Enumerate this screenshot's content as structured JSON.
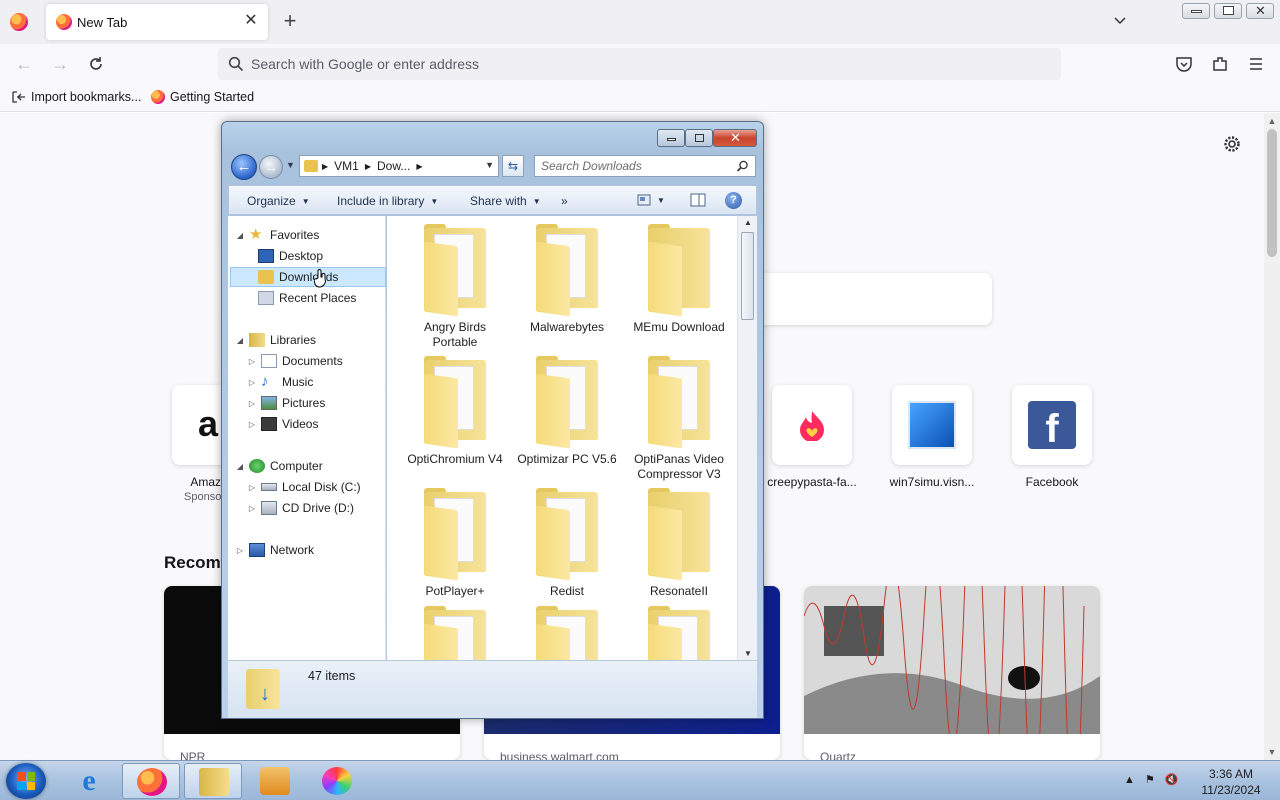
{
  "browser": {
    "tab_title": "New Tab",
    "address_placeholder": "Search with Google or enter address",
    "bookmarks": [
      {
        "label": "Import bookmarks..."
      },
      {
        "label": "Getting Started"
      }
    ]
  },
  "newtab": {
    "shortcuts": [
      {
        "label": "Amaz",
        "sub": "Sponso",
        "icon": "amazon-icon"
      },
      {
        "label": "creepypasta-fa...",
        "icon": "creepypasta-icon"
      },
      {
        "label": "win7simu.visn...",
        "icon": "win7simu-icon"
      },
      {
        "label": "Facebook",
        "icon": "facebook-icon"
      }
    ],
    "recommended_title": "Recomm",
    "cards": [
      {
        "source": "NPR"
      },
      {
        "source": "business.walmart.com"
      },
      {
        "source": "Quartz"
      }
    ]
  },
  "explorer": {
    "breadcrumb": [
      "VM1",
      "Dow..."
    ],
    "search_placeholder": "Search Downloads",
    "commands": {
      "organize": "Organize",
      "include": "Include in library",
      "share": "Share with",
      "more": "»"
    },
    "nav": {
      "favorites": "Favorites",
      "desktop": "Desktop",
      "downloads": "Downloads",
      "recent": "Recent Places",
      "libraries": "Libraries",
      "documents": "Documents",
      "music": "Music",
      "pictures": "Pictures",
      "videos": "Videos",
      "computer": "Computer",
      "local_disk": "Local Disk (C:)",
      "cd_drive": "CD Drive (D:)",
      "network": "Network"
    },
    "files": [
      {
        "name": "Angry Birds Portable"
      },
      {
        "name": "Malwarebytes"
      },
      {
        "name": "MEmu Download"
      },
      {
        "name": "OptiChromium V4"
      },
      {
        "name": "Optimizar PC V5.6"
      },
      {
        "name": "OptiPanas Video Compressor V3"
      },
      {
        "name": "PotPlayer+"
      },
      {
        "name": "Redist"
      },
      {
        "name": "ResonateII"
      }
    ],
    "status": "47 items"
  },
  "taskbar": {
    "time": "3:36 AM",
    "date": "11/23/2024"
  },
  "colors": {
    "accent": "#0060df",
    "taskbar": "#a9c2df",
    "folder": "#f4db78"
  }
}
